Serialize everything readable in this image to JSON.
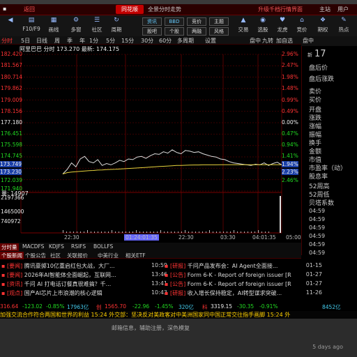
{
  "titlebar": {
    "back": "返回",
    "logo": "同花顺",
    "window_title": "全景分时走势",
    "upgrade": "升级千档行情界面",
    "menu": "主站",
    "user": "用户"
  },
  "toolbar": {
    "items": [
      {
        "icon": "◀",
        "label": ""
      },
      {
        "icon": "▤",
        "label": "F10/F9"
      },
      {
        "icon": "▦",
        "label": "画线"
      },
      {
        "icon": "⚙",
        "label": "多窗"
      },
      {
        "icon": "☰",
        "label": "社区"
      },
      {
        "icon": "↻",
        "label": "周期"
      },
      {
        "icon": "⚑",
        "label": "预警"
      },
      {
        "icon": "▲",
        "label": "交易"
      },
      {
        "icon": "◉",
        "label": "选股"
      },
      {
        "icon": "♥",
        "label": "龙虎"
      },
      {
        "icon": "⌂",
        "label": "竞价"
      },
      {
        "icon": "❖",
        "label": "期权"
      },
      {
        "icon": "✎",
        "label": "热点"
      }
    ],
    "buttons": [
      "资讯",
      "BBD",
      "竞价",
      "龙虎",
      "热点",
      "主题",
      "基金",
      "我的",
      "竞价",
      "BBD",
      "龙虎",
      "热点",
      "竞价"
    ],
    "btn_rows": [
      [
        "资讯",
        "股吧"
      ],
      [
        "BBD",
        "个股"
      ],
      [
        "竞价",
        "两融"
      ],
      [
        "主题",
        "风格"
      ]
    ]
  },
  "chart_tabs": [
    "分时",
    "5日",
    "日线",
    "周",
    "季",
    "年",
    "1分",
    "5分",
    "15分",
    "30分",
    "60分",
    "多周期",
    "设置"
  ],
  "stock": {
    "name": "阿里巴巴",
    "label_time": "分时",
    "price_label": "173.270",
    "avg_label": "最新: 174.175"
  },
  "header_right": [
    "盘中",
    "九转",
    "加自选"
  ],
  "rp_code": "17",
  "rp_code_prefix": "新",
  "rp_fields": [
    "盘后价",
    "盘后涨跌",
    "卖价",
    "买价",
    "开盘",
    "涨跌",
    "涨幅",
    "振幅",
    "换手",
    "金额",
    "市值",
    "市盈率（动）",
    "股息率",
    "52周高",
    "52周低",
    "贝塔系数"
  ],
  "rp_times": [
    "04:59",
    "04:59",
    "04:59",
    "04:59",
    "04:59",
    "04:59",
    "04:59",
    "04:59",
    "04:59",
    "04:59",
    "04:59"
  ],
  "left_prices": [
    "182.420",
    "181.567",
    "180.714",
    "179.862",
    "179.009",
    "178.156",
    "177.180",
    "176.451",
    "175.598",
    "174.745",
    "173.749",
    "173.230",
    "172.039",
    "171.940"
  ],
  "right_pcts": [
    "2.96%",
    "2.47%",
    "1.98%",
    "1.48%",
    "0.99%",
    "0.49%",
    "0.00%",
    "0.47%",
    "0.94%",
    "1.41%",
    "1.94%",
    "2.23%",
    "2.46%",
    "2.96%"
  ],
  "volume": {
    "label": "量",
    "value": "14907",
    "left_vals": [
      "2197366",
      "1465000",
      "740972"
    ]
  },
  "x_axis": [
    "22:30",
    "01:24:01:35",
    "22:30",
    "03:30",
    "04:01:35",
    "05:00"
  ],
  "chart_data": {
    "type": "line",
    "title": "",
    "xlabel": "",
    "ylabel": "",
    "ylim": [
      171.94,
      182.42
    ],
    "series": [
      {
        "name": "",
        "values": [
          173.25,
          173.6,
          174.1,
          173.8,
          174.4,
          174.6,
          174.2,
          174.1,
          174.35,
          173.9,
          174.05,
          173.95,
          174.1,
          174.3,
          174.2,
          174.4,
          174.35,
          174.55,
          174.6,
          174.45,
          174.65,
          174.8,
          174.75,
          174.95,
          174.85,
          175.1,
          174.9,
          174.8,
          175.05,
          175.0,
          174.9,
          174.95,
          174.8,
          174.7,
          174.6,
          174.55,
          174.4,
          174.35,
          174.2,
          174.1,
          174.05,
          174.0,
          173.95,
          173.9,
          174.0,
          173.95,
          174.1,
          173.9,
          174.05,
          174.15,
          173.95
        ]
      },
      {
        "name": "",
        "values": [
          173.25,
          173.35,
          173.4,
          173.42,
          173.45,
          173.48,
          173.5,
          173.52,
          173.55,
          173.56,
          173.58,
          173.6,
          173.61,
          173.63,
          173.65,
          173.67,
          173.69,
          173.71,
          173.73,
          173.75,
          173.78,
          173.8,
          173.82,
          173.84,
          173.86,
          173.88,
          173.9,
          173.91,
          173.92,
          173.93,
          173.94,
          173.94,
          173.95,
          173.95,
          173.95,
          173.95,
          173.96,
          173.96,
          173.96,
          173.96,
          173.96,
          173.96,
          173.96,
          173.96,
          173.96,
          173.96,
          173.96,
          173.96,
          173.96,
          173.96,
          173.96
        ]
      }
    ]
  },
  "subtabs": [
    "分时量",
    "MACDFS",
    "KDJFS",
    "RSIFS",
    "BOLLFS"
  ],
  "subtabs2": [
    "个股新闻",
    "个股公告",
    "社区",
    "关联报价",
    "中美行业",
    "相关ETF"
  ],
  "news_left": [
    {
      "tag": "要闻",
      "title": "腾讯豪掷10亿重启红包大战，大厂...",
      "time": "10:59"
    },
    {
      "tag": "要闻",
      "title": "2026年AI智能体全面崛起，互联网...",
      "time": "13:46"
    },
    {
      "tag": "资讯",
      "title": "千问 AI 打电话订餐真很难搞？千...",
      "time": "13:41"
    },
    {
      "tag": "观点",
      "title": "国产AI芯片上市浪潮的核心逻辑",
      "time": "10:43"
    },
    {
      "tag": "观点",
      "title": "7股中天气向专推荐！云计算ETF震...",
      "time": "10:40"
    },
    {
      "tag": "研报",
      "title": "600916 ：3龙净器，贵金属 全线",
      "time": "10:40"
    }
  ],
  "news_right": [
    {
      "tag": "研报",
      "title": "千问产品发布会：AI Agent全面接...",
      "time": "01-15"
    },
    {
      "tag": "公告",
      "title": "Form 6-K - Report of foreign issuer [R",
      "time": "01-27"
    },
    {
      "tag": "公告",
      "title": "Form 6-K - Report of foreign issuer [R",
      "time": "01-27"
    },
    {
      "tag": "研报",
      "title": "收入增长保持稳定，AI转型谋求突破...",
      "time": "11-26"
    },
    {
      "tag": "公告",
      "title": "Form 6-K - Report of foreign issuer [R",
      "time": "11-25"
    },
    {
      "tag": "公告",
      "title": "Form 6-K - Report of foreign issuer [R",
      "time": "11-25"
    }
  ],
  "ticker": [
    {
      "text": "316.64",
      "color": "red"
    },
    {
      "text": "-123.02",
      "color": "green"
    },
    {
      "text": "-0.85%",
      "color": "green"
    },
    {
      "text": "17963亿",
      "color": "cyan"
    },
    {
      "text": "创",
      "color": "red"
    },
    {
      "text": "1565.70",
      "color": "red"
    },
    {
      "text": "-22.96",
      "color": "green"
    },
    {
      "text": "-1.45%",
      "color": "green"
    },
    {
      "text": "320亿",
      "color": "cyan"
    },
    {
      "text": "科",
      "color": "red"
    },
    {
      "text": "3319.15",
      "color": "white"
    },
    {
      "text": "-30.35",
      "color": "green"
    },
    {
      "text": "-0.91%",
      "color": "green"
    },
    {
      "text": "8452亿",
      "color": "cyan"
    }
  ],
  "scroll_news": "加强交流合作符合两国和世界的利益           15:24 外交部：坚决反对美政客对中美洲国家同中国正常交往指手画脚                        15:24 外",
  "notification": {
    "message": "邮箱信息，辅助注册，深色模复",
    "ago": "5 days ago"
  }
}
